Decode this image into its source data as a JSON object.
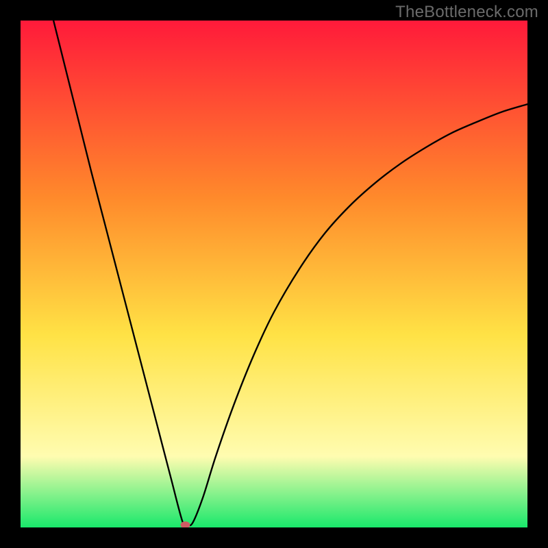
{
  "watermark": "TheBottleneck.com",
  "chart_data": {
    "type": "line",
    "title": "",
    "xlabel": "",
    "ylabel": "",
    "xlim": [
      0,
      100
    ],
    "ylim": [
      0,
      100
    ],
    "grid": false,
    "legend": false,
    "background_gradient": {
      "top": "#ff1a3a",
      "mid1": "#ff8a2b",
      "mid2": "#ffe245",
      "mid3": "#fffcb0",
      "bottom": "#19e86b"
    },
    "series": [
      {
        "name": "bottleneck-curve",
        "color": "#000000",
        "points": [
          {
            "x": 6.5,
            "y": 100.0
          },
          {
            "x": 9.0,
            "y": 90.0
          },
          {
            "x": 11.5,
            "y": 80.0
          },
          {
            "x": 14.0,
            "y": 70.0
          },
          {
            "x": 16.6,
            "y": 60.0
          },
          {
            "x": 19.2,
            "y": 50.0
          },
          {
            "x": 21.8,
            "y": 40.0
          },
          {
            "x": 24.4,
            "y": 30.0
          },
          {
            "x": 27.0,
            "y": 20.0
          },
          {
            "x": 29.6,
            "y": 10.0
          },
          {
            "x": 32.0,
            "y": 1.0
          },
          {
            "x": 33.0,
            "y": 0.5
          },
          {
            "x": 34.0,
            "y": 1.0
          },
          {
            "x": 36.0,
            "y": 6.0
          },
          {
            "x": 38.5,
            "y": 14.0
          },
          {
            "x": 42.0,
            "y": 24.0
          },
          {
            "x": 46.0,
            "y": 34.0
          },
          {
            "x": 50.0,
            "y": 42.5
          },
          {
            "x": 55.0,
            "y": 51.0
          },
          {
            "x": 60.0,
            "y": 58.0
          },
          {
            "x": 65.0,
            "y": 63.5
          },
          {
            "x": 70.0,
            "y": 68.0
          },
          {
            "x": 75.0,
            "y": 71.8
          },
          {
            "x": 80.0,
            "y": 75.0
          },
          {
            "x": 85.0,
            "y": 77.8
          },
          {
            "x": 90.0,
            "y": 80.0
          },
          {
            "x": 95.0,
            "y": 82.0
          },
          {
            "x": 100.0,
            "y": 83.5
          }
        ]
      }
    ],
    "marker": {
      "name": "optimum-point",
      "x": 32.5,
      "y": 0.5,
      "color": "#cf5a63",
      "rx": 7,
      "ry": 5
    }
  }
}
